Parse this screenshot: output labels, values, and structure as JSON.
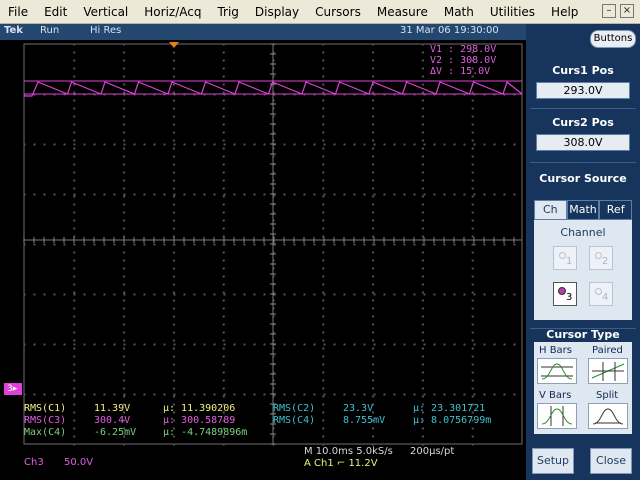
{
  "menu": [
    "File",
    "Edit",
    "Vertical",
    "Horiz/Acq",
    "Trig",
    "Display",
    "Cursors",
    "Measure",
    "Math",
    "Utilities",
    "Help"
  ],
  "status": {
    "brand": "Tek",
    "run": "Run",
    "mode": "Hi Res",
    "datetime": "31 Mar 06 19:30:00"
  },
  "cursor_readout": {
    "v1": "V1 :  298.0V",
    "v2": "V2 :  308.0V",
    "dv": "ΔV :    15.0V"
  },
  "ground_marker": "3",
  "measurements": [
    {
      "name": "RMS(C1)",
      "value": "11.39V",
      "mean": "µ: 11.390206",
      "color": "#f0f080"
    },
    {
      "name": "RMS(C3)",
      "value": "300.4V",
      "mean": "µ: 300.58789",
      "color": "#e060e0"
    },
    {
      "name": "Max(C4)",
      "value": "-6.25mV",
      "mean": "µ: -4.7489896m",
      "color": "#7fd07f"
    },
    {
      "name": "RMS(C2)",
      "value": "23.3V",
      "mean": "µ: 23.301721",
      "color": "#40c0d0"
    },
    {
      "name": "RMS(C4)",
      "value": "8.755mV",
      "mean": "µ: 8.0756799m",
      "color": "#40c0d0"
    }
  ],
  "bottom": {
    "ch_label": "Ch3",
    "ch_scale": "50.0V",
    "timebase": "M 10.0ms 5.0kS/s",
    "resolution": "200µs/pt",
    "trigger": "A  Ch1  ⌐  11.2V"
  },
  "panel": {
    "buttons_label": "Buttons",
    "curs1_title": "Curs1 Pos",
    "curs1_value": "293.0V",
    "curs2_title": "Curs2 Pos",
    "curs2_value": "308.0V",
    "source_title": "Cursor Source",
    "tabs": [
      "Ch",
      "Math",
      "Ref"
    ],
    "channel_label": "Channel",
    "channels": [
      "1",
      "2",
      "3",
      "4"
    ],
    "selected_channel": "3",
    "type_title": "Cursor Type",
    "type_hbars": "H Bars",
    "type_paired": "Paired",
    "type_vbars": "V Bars",
    "type_split": "Split",
    "setup": "Setup",
    "close": "Close"
  },
  "colors": {
    "trace": "#e040d8",
    "grid": "#6f6f6f",
    "cursor": "#e040d8",
    "accent": "#1f3d66"
  }
}
